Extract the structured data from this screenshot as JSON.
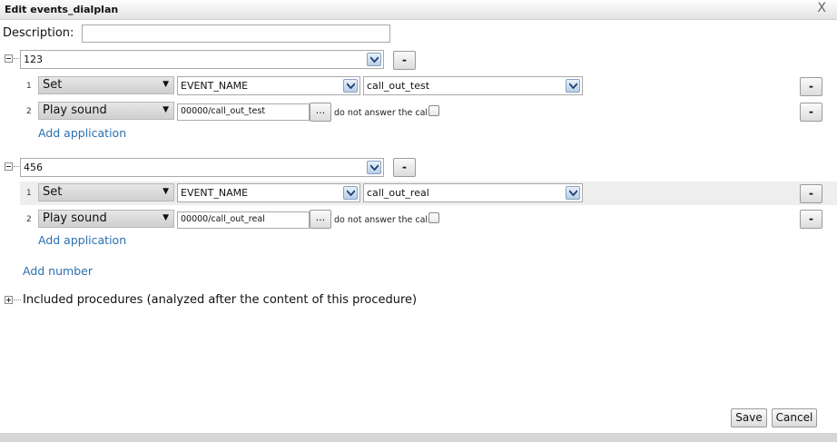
{
  "window": {
    "title": "Edit events_dialplan",
    "close_glyph": "X"
  },
  "description": {
    "label": "Description:",
    "value": ""
  },
  "numbers": [
    {
      "number": "123",
      "remove_label": "-",
      "applications": [
        {
          "index": "1",
          "type": "Set",
          "variable": "EVENT_NAME",
          "value": "call_out_test",
          "remove_label": "-"
        },
        {
          "index": "2",
          "type": "Play sound",
          "file": "00000/call_out_test",
          "browse_label": "...",
          "no_answer_label": "do not answer the call",
          "no_answer_checked": false,
          "remove_label": "-"
        }
      ],
      "add_application_label": "Add application"
    },
    {
      "number": "456",
      "remove_label": "-",
      "applications": [
        {
          "index": "1",
          "type": "Set",
          "variable": "EVENT_NAME",
          "value": "call_out_real",
          "remove_label": "-"
        },
        {
          "index": "2",
          "type": "Play sound",
          "file": "00000/call_out_real",
          "browse_label": "...",
          "no_answer_label": "do not answer the call",
          "no_answer_checked": false,
          "remove_label": "-"
        }
      ],
      "add_application_label": "Add application"
    }
  ],
  "add_number_label": "Add number",
  "included_procedures_label": "Included procedures (analyzed after the content of this procedure)",
  "buttons": {
    "save": "Save",
    "cancel": "Cancel"
  }
}
